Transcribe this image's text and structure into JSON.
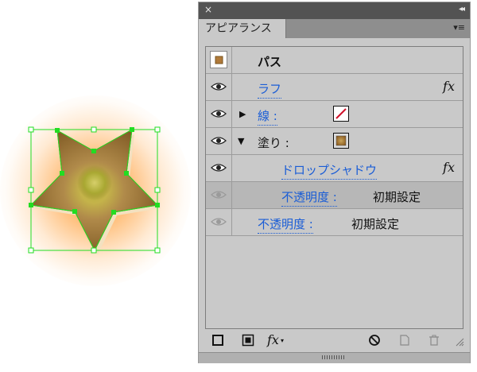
{
  "colors": {
    "selection_green": "#22dd22",
    "link_blue": "#1a5dd6",
    "star_fill_dark": "#7a5520",
    "star_fill_light": "#c7a05a",
    "center_glow": "#b7b33a",
    "glow_orange": "#ff9628"
  },
  "panel": {
    "tab_label": "アピアランス",
    "close_glyph": "×",
    "collapse_glyph": "◂◂",
    "menu_glyph": "▾≡"
  },
  "rows": {
    "header": {
      "label": "パス"
    },
    "roughen": {
      "label": "ラフ",
      "fx": "fx"
    },
    "stroke": {
      "label": "線 :"
    },
    "fill": {
      "label": "塗り :"
    },
    "drop_shadow": {
      "label": "ドロップシャドウ",
      "fx": "fx"
    },
    "shadow_opacity": {
      "label": "不透明度 :",
      "value": "初期設定"
    },
    "opacity": {
      "label": "不透明度 :",
      "value": "初期設定"
    }
  },
  "bottom_icons": [
    "add-stroke-icon",
    "add-fill-icon",
    "fx-menu-icon",
    "clear-appearance-icon",
    "duplicate-item-icon",
    "delete-item-icon"
  ],
  "fx_menu_label": "fx"
}
